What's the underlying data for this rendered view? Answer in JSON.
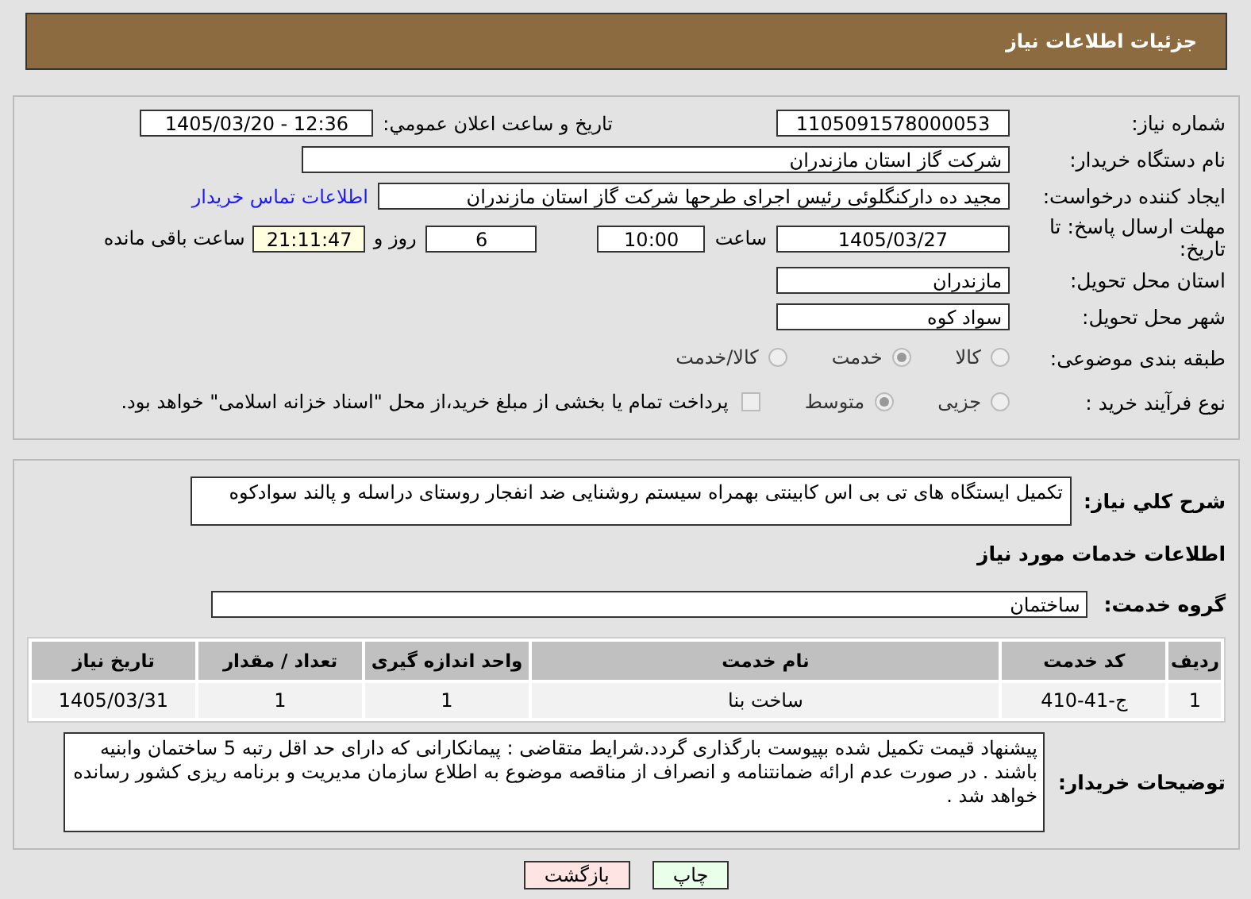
{
  "header": {
    "title": "جزئیات اطلاعات نیاز"
  },
  "details": {
    "need_number": {
      "label": "شماره نیاز:",
      "value": "1105091578000053"
    },
    "announce": {
      "label": "تاریخ و ساعت اعلان عمومي:",
      "value": "1405/03/20 - 12:36"
    },
    "buyer": {
      "label": "نام دستگاه خریدار:",
      "value": "شرکت گاز استان مازندران"
    },
    "creator": {
      "label": "ایجاد کننده درخواست:",
      "value": "مجید ده دارکنگلوئی رئیس اجرای طرحها شرکت گاز استان مازندران",
      "link": "اطلاعات تماس خریدار"
    },
    "deadline": {
      "label": "مهلت ارسال پاسخ: تا تاریخ:",
      "date": "1405/03/27",
      "time_label": "ساعت",
      "time": "10:00",
      "days": "6",
      "days_label": "روز و",
      "remaining": "21:11:47",
      "remaining_label": "ساعت باقی مانده"
    },
    "province": {
      "label": "استان محل تحویل:",
      "value": "مازندران"
    },
    "city": {
      "label": "شهر محل تحویل:",
      "value": "سواد کوه"
    },
    "category": {
      "label": "طبقه بندی موضوعی:",
      "options": [
        {
          "label": "کالا",
          "selected": false
        },
        {
          "label": "خدمت",
          "selected": true
        },
        {
          "label": "کالا/خدمت",
          "selected": false
        }
      ]
    },
    "process": {
      "label": "نوع فرآیند خرید :",
      "options": [
        {
          "label": "جزیی",
          "selected": false
        },
        {
          "label": "متوسط",
          "selected": true
        }
      ],
      "payment": {
        "label": "پرداخت تمام یا بخشی از مبلغ خرید،از محل \"اسناد خزانه اسلامی\" خواهد بود.",
        "checked": false
      }
    }
  },
  "summary": {
    "label": "شرح کلي نياز:",
    "value": "تکمیل ایستگاه های تی بی اس کابینتی بهمراه سیستم روشنایی ضد انفجار روستای دراسله و پالند سوادکوه"
  },
  "services": {
    "title": "اطلاعات خدمات مورد نياز",
    "group_label": "گروه خدمت:",
    "group": "ساختمان",
    "table": {
      "columns": [
        "ردیف",
        "کد خدمت",
        "نام خدمت",
        "واحد اندازه گیری",
        "تعداد / مقدار",
        "تاریخ نیاز"
      ],
      "rows": [
        [
          "1",
          "ج-41-410",
          "ساخت بنا",
          "1",
          "1",
          "1405/03/31"
        ]
      ]
    }
  },
  "buyer_notes": {
    "label": "توضیحات خریدار:",
    "value": "پیشنهاد قیمت تکمیل شده بپیوست بارگذاری گردد.شرایط متقاضی : پیمانکارانی که دارای حد اقل رتبه 5 ساختمان وابنیه باشند . در صورت عدم ارائه ضمانتنامه و انصراف از مناقصه موضوع به اطلاع سازمان مدیریت و برنامه ریزی کشور رسانده خواهد شد ."
  },
  "buttons": [
    {
      "label": "چاپ",
      "kind": "print"
    },
    {
      "label": "بازگشت",
      "kind": "back"
    }
  ]
}
